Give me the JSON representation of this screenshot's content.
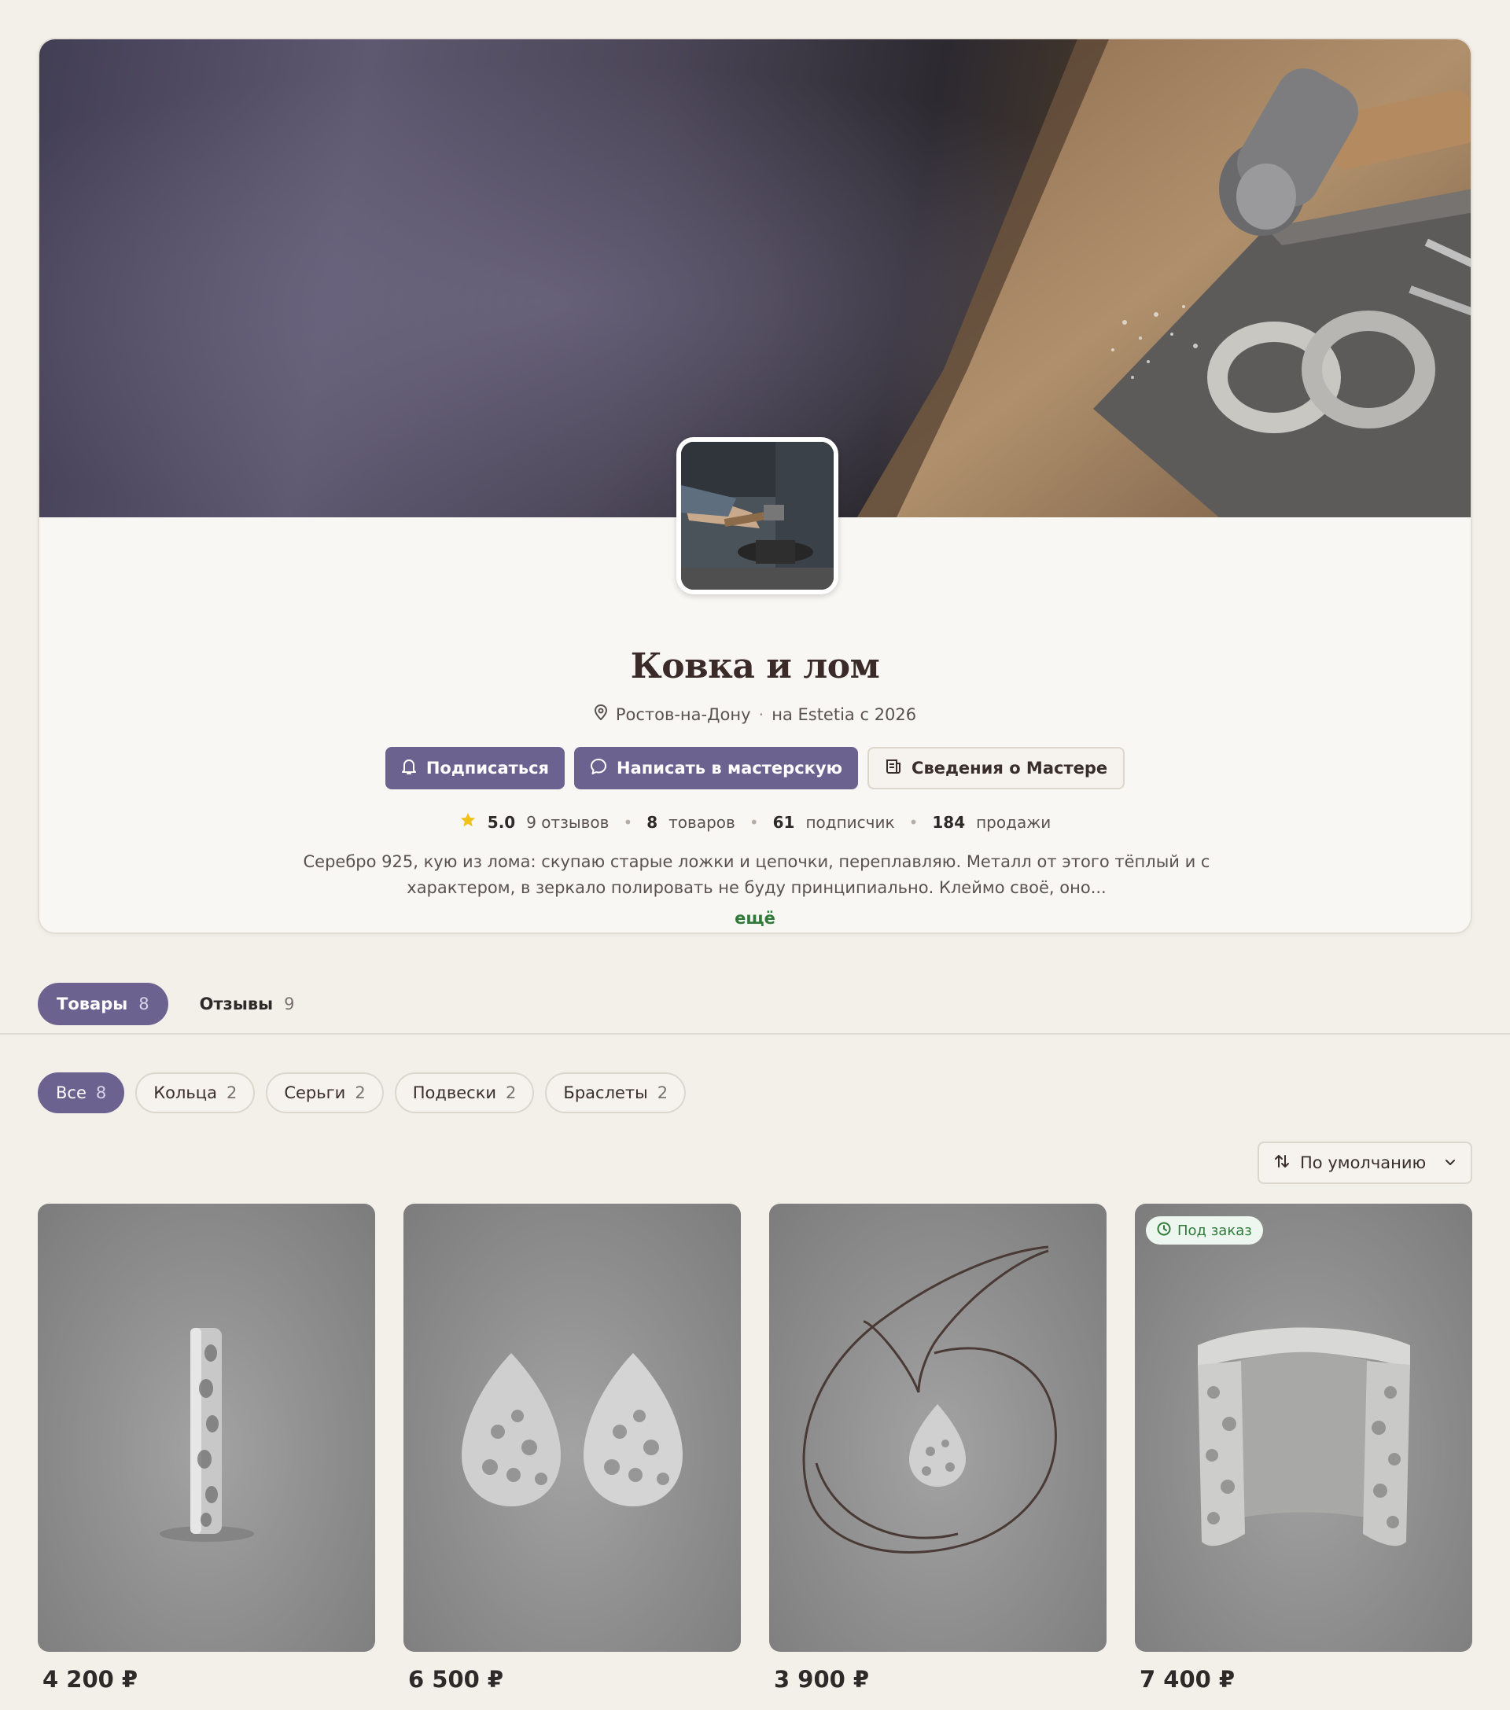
{
  "shop": {
    "name": "Ковка и лом",
    "location": "Ростов-на-Дону",
    "since": "на Estetia с 2026",
    "separator": "·"
  },
  "actions": {
    "subscribe": "Подписаться",
    "message": "Написать в мастерскую",
    "about": "Сведения о Мастере"
  },
  "stats": {
    "rating": "5.0",
    "reviews": "9 отзывов",
    "products_count": "8",
    "products_label": "товаров",
    "followers_count": "61",
    "followers_label": "подписчик",
    "sales_count": "184",
    "sales_label": "продажи"
  },
  "bio": {
    "text": "Серебро 925, кую из лома: скупаю старые ложки и цепочки, переплавляю. Металл от этого тёплый и с характером, в зеркало полировать не буду принципиально. Клеймо своё, оно...",
    "more": "ещё"
  },
  "tabs": [
    {
      "label": "Товары",
      "count": "8"
    },
    {
      "label": "Отзывы",
      "count": "9"
    }
  ],
  "categories": [
    {
      "label": "Все",
      "count": "8"
    },
    {
      "label": "Кольца",
      "count": "2"
    },
    {
      "label": "Серьги",
      "count": "2"
    },
    {
      "label": "Подвески",
      "count": "2"
    },
    {
      "label": "Браслеты",
      "count": "2"
    }
  ],
  "sort": {
    "label": "По умолчанию"
  },
  "products": [
    {
      "price": "4 200 ₽",
      "badge": ""
    },
    {
      "price": "6 500 ₽",
      "badge": ""
    },
    {
      "price": "3 900 ₽",
      "badge": ""
    },
    {
      "price": "7 400 ₽",
      "badge": "Под заказ"
    }
  ],
  "colors": {
    "accent": "#6b6290",
    "link": "#2f7a3a",
    "background": "#f3f0ea",
    "star": "#f2c21b"
  }
}
